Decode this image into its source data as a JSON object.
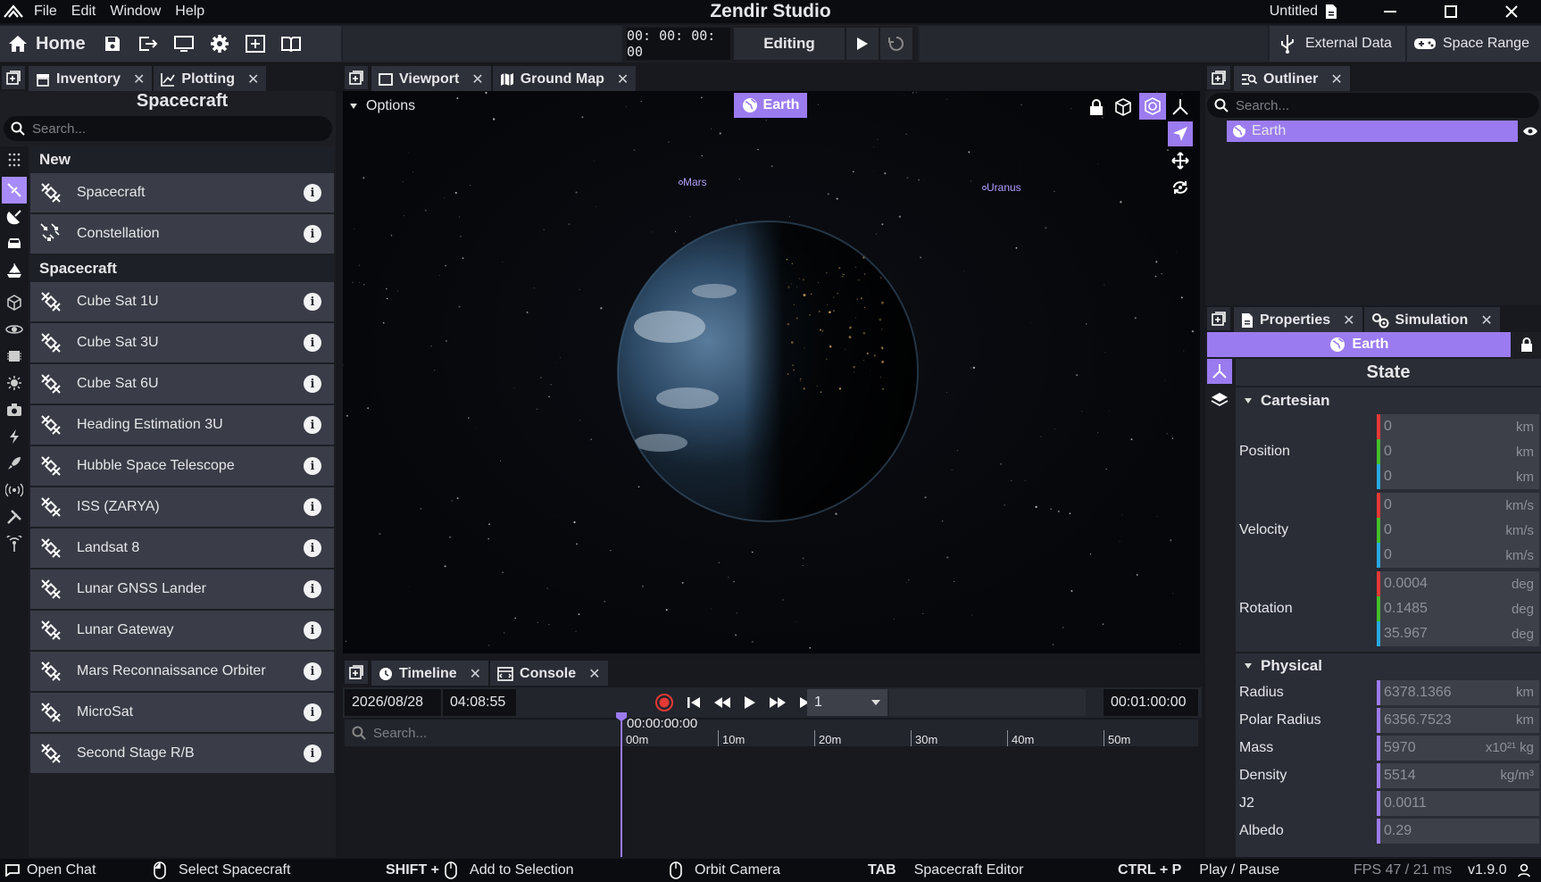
{
  "menu": {
    "items": [
      "File",
      "Edit",
      "Window",
      "Help"
    ]
  },
  "app_title": "Zendir Studio",
  "doc_title": "Untitled",
  "toolbar": {
    "home_label": "Home",
    "timer": "00: 00: 00: 00",
    "mode": "Editing",
    "external_data": "External Data",
    "space_range": "Space Range"
  },
  "inventory": {
    "tab_inventory": "Inventory",
    "tab_plotting": "Plotting",
    "title": "Spacecraft",
    "search_placeholder": "Search...",
    "section_new": "New",
    "new_items": [
      {
        "label": "Spacecraft",
        "icon": "satellite-icon"
      },
      {
        "label": "Constellation",
        "icon": "constellation-icon"
      }
    ],
    "section_spacecraft": "Spacecraft",
    "spacecraft_items": [
      {
        "label": "Cube Sat 1U"
      },
      {
        "label": "Cube Sat 3U"
      },
      {
        "label": "Cube Sat 6U"
      },
      {
        "label": "Heading Estimation 3U"
      },
      {
        "label": "Hubble Space Telescope"
      },
      {
        "label": "ISS (ZARYA)"
      },
      {
        "label": "Landsat 8"
      },
      {
        "label": "Lunar GNSS Lander"
      },
      {
        "label": "Lunar Gateway"
      },
      {
        "label": "Mars Reconnaissance Orbiter"
      },
      {
        "label": "MicroSat"
      },
      {
        "label": "Second Stage R/B"
      }
    ]
  },
  "viewport": {
    "tab_viewport": "Viewport",
    "tab_groundmap": "Ground Map",
    "options_label": "Options",
    "focus_badge": "Earth",
    "planet_labels": {
      "mars": "Mars",
      "uranus": "Uranus"
    }
  },
  "timeline": {
    "tab_timeline": "Timeline",
    "tab_console": "Console",
    "date": "2026/08/28",
    "time": "04:08:55",
    "speed": "1",
    "end_time": "00:01:00:00",
    "search_placeholder": "Search...",
    "cursor_time": "00:00:00:00",
    "ticks": [
      "00m",
      "10m",
      "20m",
      "30m",
      "40m",
      "50m"
    ]
  },
  "outliner": {
    "tab": "Outliner",
    "search_placeholder": "Search...",
    "item": "Earth"
  },
  "properties": {
    "tab_properties": "Properties",
    "tab_simulation": "Simulation",
    "selected": "Earth",
    "state_title": "State",
    "cartesian_label": "Cartesian",
    "position_label": "Position",
    "velocity_label": "Velocity",
    "rotation_label": "Rotation",
    "position": [
      {
        "value": "0",
        "unit": "km",
        "color": "#e53935"
      },
      {
        "value": "0",
        "unit": "km",
        "color": "#43c02c"
      },
      {
        "value": "0",
        "unit": "km",
        "color": "#27a8e0"
      }
    ],
    "velocity": [
      {
        "value": "0",
        "unit": "km/s",
        "color": "#e53935"
      },
      {
        "value": "0",
        "unit": "km/s",
        "color": "#43c02c"
      },
      {
        "value": "0",
        "unit": "km/s",
        "color": "#27a8e0"
      }
    ],
    "rotation": [
      {
        "value": "0.0004",
        "unit": "deg",
        "color": "#e53935"
      },
      {
        "value": "0.1485",
        "unit": "deg",
        "color": "#43c02c"
      },
      {
        "value": "35.967",
        "unit": "deg",
        "color": "#27a8e0"
      }
    ],
    "physical_label": "Physical",
    "physical": [
      {
        "label": "Radius",
        "value": "6378.1366",
        "unit": "km"
      },
      {
        "label": "Polar Radius",
        "value": "6356.7523",
        "unit": "km"
      },
      {
        "label": "Mass",
        "value": "5970",
        "unit": "x10²¹ kg"
      },
      {
        "label": "Density",
        "value": "5514",
        "unit": "kg/m³"
      },
      {
        "label": "J2",
        "value": "0.0011",
        "unit": ""
      },
      {
        "label": "Albedo",
        "value": "0.29",
        "unit": ""
      }
    ],
    "physical_color": "#9b7bf0"
  },
  "statusbar": {
    "open_chat": "Open Chat",
    "select_spacecraft": "Select Spacecraft",
    "shift_key": "SHIFT +",
    "add_to_selection": "Add to Selection",
    "orbit_camera": "Orbit Camera",
    "tab_key": "TAB",
    "spacecraft_editor": "Spacecraft Editor",
    "ctrlp_key": "CTRL + P",
    "play_pause": "Play / Pause",
    "fps": "FPS 47 / 21 ms",
    "version": "v1.9.0"
  },
  "colors": {
    "accent": "#9b7bf0",
    "panel": "#22252c",
    "row": "#3a3d47"
  }
}
